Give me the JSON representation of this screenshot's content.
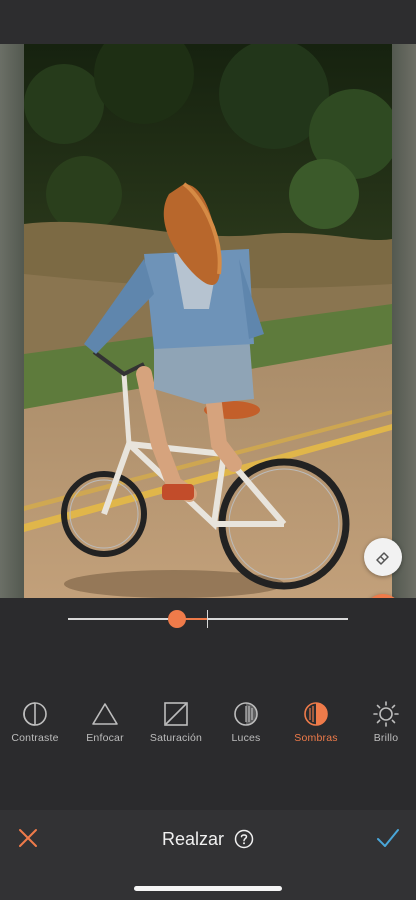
{
  "editor": {
    "title": "Realzar",
    "accent_color": "#ef7b4a",
    "confirm_color": "#4aa6d8"
  },
  "slider": {
    "value": 0.39,
    "center": 0.5
  },
  "tools": [
    {
      "label": "Contraste",
      "icon": "contrast-icon",
      "active": false
    },
    {
      "label": "Enfocar",
      "icon": "sharpen-triangle-icon",
      "active": false
    },
    {
      "label": "Saturación",
      "icon": "saturation-icon",
      "active": false
    },
    {
      "label": "Luces",
      "icon": "highlights-icon",
      "active": false
    },
    {
      "label": "Sombras",
      "icon": "shadows-icon",
      "active": true
    },
    {
      "label": "Brillo",
      "icon": "brightness-sun-icon",
      "active": false
    }
  ]
}
